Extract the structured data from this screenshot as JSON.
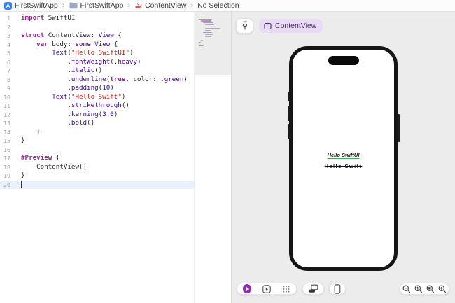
{
  "breadcrumb": {
    "separator": "›",
    "items": [
      {
        "icon": "app",
        "label": "FirstSwiftApp"
      },
      {
        "icon": "folder",
        "label": "FirstSwiftApp"
      },
      {
        "icon": "swift",
        "label": "ContentView"
      },
      {
        "icon": "none",
        "label": "No Selection"
      }
    ]
  },
  "editor": {
    "current_line": 20,
    "lines": [
      {
        "n": 1,
        "tk": [
          [
            "import",
            "k"
          ],
          [
            " SwiftUI",
            "p"
          ]
        ]
      },
      {
        "n": 2,
        "tk": []
      },
      {
        "n": 3,
        "tk": [
          [
            "struct",
            "k"
          ],
          [
            " ContentView: ",
            "p"
          ],
          [
            "View",
            "t"
          ],
          [
            " {",
            "p"
          ]
        ]
      },
      {
        "n": 4,
        "tk": [
          [
            "    ",
            "p"
          ],
          [
            "var",
            "k"
          ],
          [
            " body: ",
            "p"
          ],
          [
            "some",
            "k"
          ],
          [
            " ",
            "p"
          ],
          [
            "View",
            "t"
          ],
          [
            " {",
            "p"
          ]
        ]
      },
      {
        "n": 5,
        "tk": [
          [
            "        ",
            "p"
          ],
          [
            "Text",
            "t"
          ],
          [
            "(",
            "p"
          ],
          [
            "\"Hello SwiftUI\"",
            "s"
          ],
          [
            ")",
            "p"
          ]
        ]
      },
      {
        "n": 6,
        "tk": [
          [
            "            .",
            "p"
          ],
          [
            "fontWeight",
            "t"
          ],
          [
            "(.",
            "p"
          ],
          [
            "heavy",
            "t"
          ],
          [
            ")",
            "p"
          ]
        ]
      },
      {
        "n": 7,
        "tk": [
          [
            "            .",
            "p"
          ],
          [
            "italic",
            "t"
          ],
          [
            "()",
            "p"
          ]
        ]
      },
      {
        "n": 8,
        "tk": [
          [
            "            .",
            "p"
          ],
          [
            "underline",
            "t"
          ],
          [
            "(",
            "p"
          ],
          [
            "true",
            "k"
          ],
          [
            ", color: .",
            "p"
          ],
          [
            "green",
            "t"
          ],
          [
            ")",
            "p"
          ]
        ]
      },
      {
        "n": 9,
        "tk": [
          [
            "            .",
            "p"
          ],
          [
            "padding",
            "t"
          ],
          [
            "(",
            "p"
          ],
          [
            "10",
            "n"
          ],
          [
            ")",
            "p"
          ]
        ]
      },
      {
        "n": 10,
        "tk": [
          [
            "        ",
            "p"
          ],
          [
            "Text",
            "t"
          ],
          [
            "(",
            "p"
          ],
          [
            "\"Hello Swift\"",
            "s"
          ],
          [
            ")",
            "p"
          ]
        ]
      },
      {
        "n": 11,
        "tk": [
          [
            "            .",
            "p"
          ],
          [
            "strikethrough",
            "t"
          ],
          [
            "()",
            "p"
          ]
        ]
      },
      {
        "n": 12,
        "tk": [
          [
            "            .",
            "p"
          ],
          [
            "kerning",
            "t"
          ],
          [
            "(",
            "p"
          ],
          [
            "3.0",
            "n"
          ],
          [
            ")",
            "p"
          ]
        ]
      },
      {
        "n": 13,
        "tk": [
          [
            "            .",
            "p"
          ],
          [
            "bold",
            "t"
          ],
          [
            "()",
            "p"
          ]
        ]
      },
      {
        "n": 14,
        "tk": [
          [
            "    }",
            "p"
          ]
        ]
      },
      {
        "n": 15,
        "tk": [
          [
            "}",
            "p"
          ]
        ]
      },
      {
        "n": 16,
        "tk": []
      },
      {
        "n": 17,
        "tk": [
          [
            "#Preview",
            "k"
          ],
          [
            " {",
            "p"
          ]
        ]
      },
      {
        "n": 18,
        "tk": [
          [
            "    ContentView()",
            "p"
          ]
        ]
      },
      {
        "n": 19,
        "tk": [
          [
            "}",
            "p"
          ]
        ]
      },
      {
        "n": 20,
        "tk": []
      }
    ]
  },
  "canvas": {
    "preview_pill_label": "ContentView",
    "preview": {
      "line1": "Hello SwiftUI",
      "line2": "Hello Swift"
    }
  },
  "colors": {
    "syntax_keyword": "#9B2393",
    "syntax_type": "#3900A0",
    "syntax_string": "#C41A16",
    "syntax_number": "#1C00CF",
    "syntax_plain": "#262626",
    "current_line_bg": "#e7f0fb",
    "canvas_bg": "#ececec",
    "pill_bg": "#EADBF4",
    "pill_text": "#4B2D66",
    "play_button": "#8F2FB8",
    "preview_underline_green": "#3fae4a",
    "phone_frame": "#151515",
    "swift_icon_orange": "#F05138",
    "project_icon_blue": "#3b82f7"
  }
}
